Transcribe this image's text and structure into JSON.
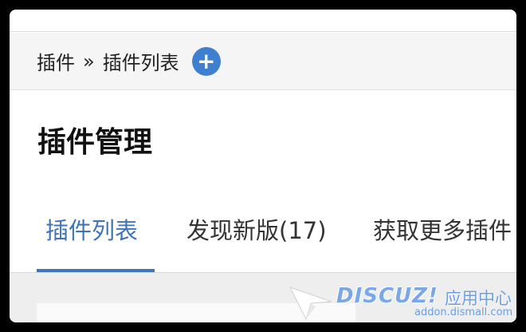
{
  "breadcrumb": {
    "root": "插件",
    "separator": "»",
    "current": "插件列表",
    "add_symbol": "+"
  },
  "page": {
    "title": "插件管理"
  },
  "tabs": [
    {
      "label": "插件列表",
      "active": true
    },
    {
      "label": "发现新版(17)",
      "active": false
    },
    {
      "label": "获取更多插件",
      "active": false
    }
  ],
  "watermark": {
    "logo_text": "DISCUZ!",
    "cn_text": "应用中心",
    "url": "addon.dismall.com"
  },
  "colors": {
    "accent": "#3f74b8",
    "add_button": "#3f7fd0",
    "breadcrumb_bg": "#f5f5f5"
  }
}
